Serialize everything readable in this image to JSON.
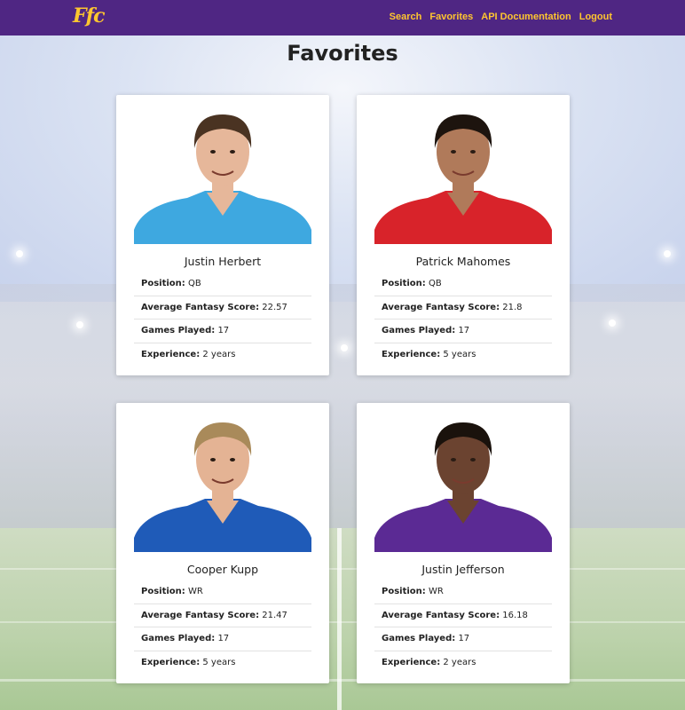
{
  "nav": {
    "logo": "Ffc",
    "links": [
      "Search",
      "Favorites",
      "API Documentation",
      "Logout"
    ]
  },
  "page": {
    "title": "Favorites"
  },
  "stat_labels": {
    "position": "Position:",
    "avg": "Average Fantasy Score:",
    "games": "Games Played:",
    "exp": "Experience:"
  },
  "players": [
    {
      "name": "Justin Herbert",
      "position": "QB",
      "avg_score": "22.57",
      "games_played": "17",
      "experience": "2 years",
      "jersey_color": "#3ea8e0",
      "hair_color": "#4a3322",
      "skin_color": "#e6b79a"
    },
    {
      "name": "Patrick Mahomes",
      "position": "QB",
      "avg_score": "21.8",
      "games_played": "17",
      "experience": "5 years",
      "jersey_color": "#d8232a",
      "hair_color": "#1d140e",
      "skin_color": "#b07a5a"
    },
    {
      "name": "Cooper Kupp",
      "position": "WR",
      "avg_score": "21.47",
      "games_played": "17",
      "experience": "5 years",
      "jersey_color": "#1f5bb8",
      "hair_color": "#a98a5a",
      "skin_color": "#e4b394"
    },
    {
      "name": "Justin Jefferson",
      "position": "WR",
      "avg_score": "16.18",
      "games_played": "17",
      "experience": "2 years",
      "jersey_color": "#5b2a94",
      "hair_color": "#1a120c",
      "skin_color": "#6b4330"
    }
  ],
  "colors": {
    "nav_bg": "#4f2683",
    "accent": "#ffc62f"
  }
}
